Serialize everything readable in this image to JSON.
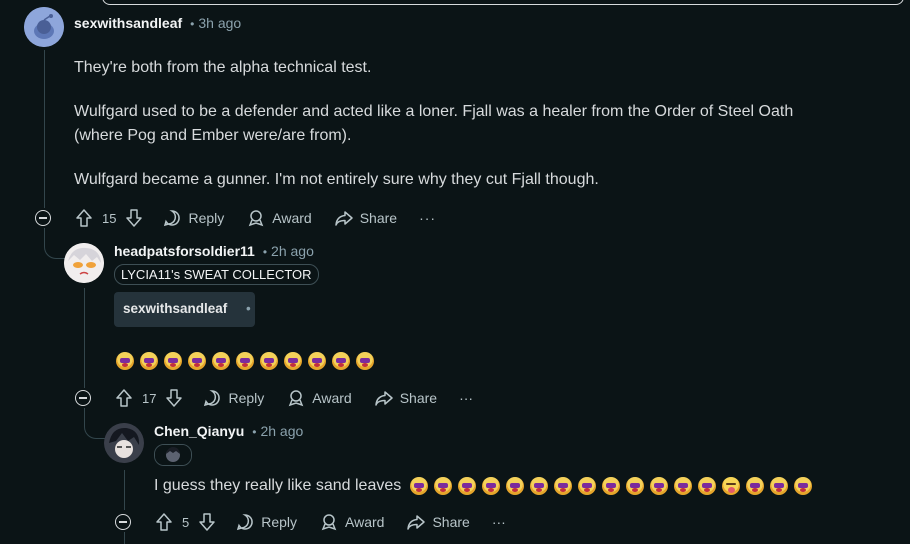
{
  "comments": [
    {
      "username": "sexwithsandleaf",
      "time": "3h ago",
      "paragraphs": [
        "They're both from the alpha technical test.",
        "Wulfgard used to be a defender and acted like a loner. Fjall was a healer from the Order of Steel Oath",
        "(where Pog and Ember were/are from).",
        "Wulfgard became a gunner. I'm not entirely sure why they cut Fjall though."
      ],
      "score": "15",
      "reply_label": "Reply",
      "award_label": "Award",
      "share_label": "Share",
      "more_label": "···"
    },
    {
      "username": "headpatsforsoldier11",
      "time": "2h ago",
      "flair": "LYCIA11's SWEAT COLLECTOR",
      "embed_user": "sexwithsandleaf",
      "embed_dot": "•",
      "emojis": [
        "crying",
        "crying",
        "crying",
        "crying",
        "crying",
        "crying",
        "crying",
        "crying",
        "crying",
        "crying",
        "crying"
      ],
      "score": "17",
      "reply_label": "Reply",
      "award_label": "Award",
      "share_label": "Share",
      "more_label": "···"
    },
    {
      "username": "Chen_Qianyu",
      "time": "2h ago",
      "text": "I guess they really like sand leaves",
      "emojis": [
        "crying",
        "crying",
        "crying",
        "crying",
        "crying",
        "crying",
        "crying",
        "crying",
        "crying",
        "crying",
        "crying",
        "crying",
        "crying",
        "tongue",
        "crying",
        "crying",
        "crying"
      ],
      "score": "5",
      "reply_label": "Reply",
      "award_label": "Award",
      "share_label": "Share",
      "more_label": "···"
    }
  ],
  "separator": "•",
  "colors": {
    "background": "#0b1416",
    "thread_line": "#33464c",
    "meta": "#8ba2ad"
  }
}
